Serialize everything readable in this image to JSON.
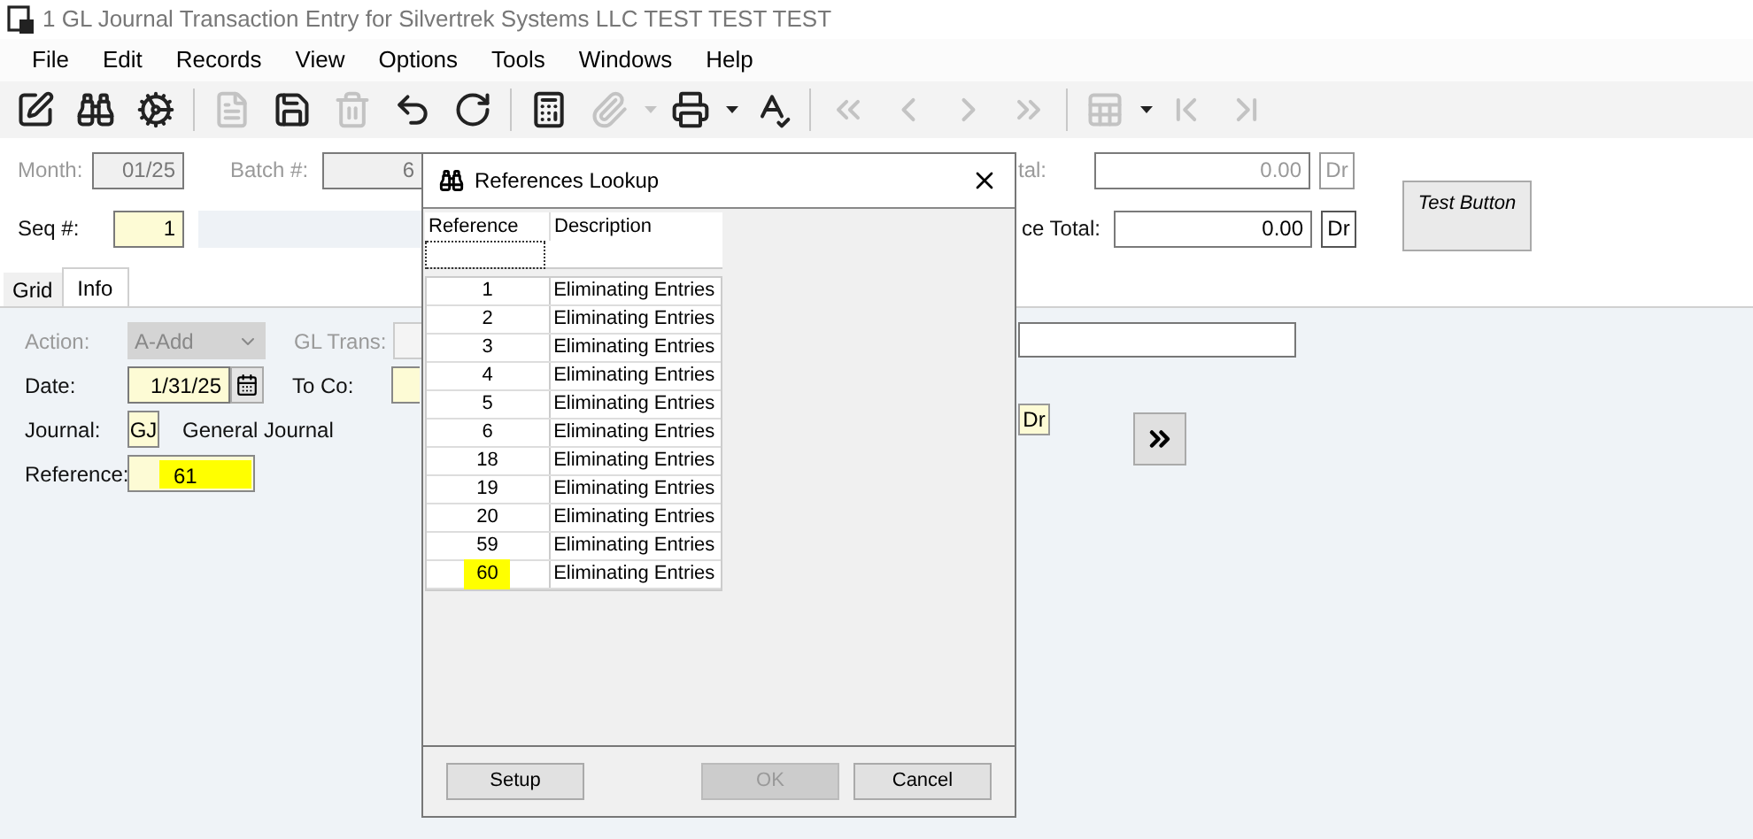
{
  "window": {
    "title": "1 GL Journal Transaction Entry for Silvertrek Systems LLC TEST TEST TEST"
  },
  "menu": [
    "File",
    "Edit",
    "Records",
    "View",
    "Options",
    "Tools",
    "Windows",
    "Help"
  ],
  "toolbar": [
    {
      "kind": "edit",
      "disabled": false
    },
    {
      "kind": "find",
      "disabled": false
    },
    {
      "kind": "gear",
      "disabled": false
    },
    {
      "kind": "separator"
    },
    {
      "kind": "document",
      "disabled": true
    },
    {
      "kind": "save",
      "disabled": false
    },
    {
      "kind": "trash",
      "disabled": true
    },
    {
      "kind": "undo",
      "disabled": false
    },
    {
      "kind": "redo",
      "disabled": false
    },
    {
      "kind": "separator"
    },
    {
      "kind": "calculator",
      "disabled": false
    },
    {
      "kind": "paperclip",
      "disabled": true
    },
    {
      "kind": "caret",
      "disabled": true
    },
    {
      "kind": "printer",
      "disabled": false
    },
    {
      "kind": "caret",
      "disabled": false
    },
    {
      "kind": "spellcheck",
      "disabled": false
    },
    {
      "kind": "separator"
    },
    {
      "kind": "first",
      "disabled": true
    },
    {
      "kind": "previous",
      "disabled": true
    },
    {
      "kind": "next",
      "disabled": true
    },
    {
      "kind": "last",
      "disabled": true
    },
    {
      "kind": "separator"
    },
    {
      "kind": "grid-settings",
      "disabled": true
    },
    {
      "kind": "caret",
      "disabled": false
    },
    {
      "kind": "begin",
      "disabled": true
    },
    {
      "kind": "end",
      "disabled": true
    }
  ],
  "header": {
    "month": {
      "label": "Month:",
      "value": "01/25"
    },
    "batch": {
      "label": "Batch #:",
      "value": "6"
    },
    "seq": {
      "label": "Seq #:",
      "value": "1"
    },
    "total_1": {
      "label": "tal:",
      "value": "0.00",
      "unit": "Dr",
      "disabled": true
    },
    "total_2": {
      "label": "ce Total:",
      "value": "0.00",
      "unit": "Dr",
      "disabled": false
    },
    "test_button": "Test Button"
  },
  "tabs": [
    {
      "label": "Grid",
      "selected": false
    },
    {
      "label": "Info",
      "selected": true
    }
  ],
  "info": {
    "action": {
      "label": "Action:",
      "value": "A-Add",
      "disabled": true
    },
    "gl_trans": {
      "label": "GL Trans:"
    },
    "date": {
      "label": "Date:",
      "value": "1/31/25"
    },
    "to_co": {
      "label": "To Co:"
    },
    "journal": {
      "label": "Journal:",
      "code": "GJ",
      "name": "General Journal"
    },
    "reference": {
      "label": "Reference:",
      "value": "61",
      "highlighted": true
    },
    "side_unit": "Dr"
  },
  "dialog": {
    "title": "References Lookup",
    "columns": [
      "Reference",
      "Description"
    ],
    "rows": [
      {
        "reference": "1",
        "description": "Eliminating Entries",
        "highlighted": false
      },
      {
        "reference": "2",
        "description": "Eliminating Entries",
        "highlighted": false
      },
      {
        "reference": "3",
        "description": "Eliminating Entries",
        "highlighted": false
      },
      {
        "reference": "4",
        "description": "Eliminating Entries",
        "highlighted": false
      },
      {
        "reference": "5",
        "description": "Eliminating Entries",
        "highlighted": false
      },
      {
        "reference": "6",
        "description": "Eliminating Entries",
        "highlighted": false
      },
      {
        "reference": "18",
        "description": "Eliminating Entries",
        "highlighted": false
      },
      {
        "reference": "19",
        "description": "Eliminating Entries",
        "highlighted": false
      },
      {
        "reference": "20",
        "description": "Eliminating Entries",
        "highlighted": false
      },
      {
        "reference": "59",
        "description": "Eliminating Entries",
        "highlighted": false
      },
      {
        "reference": "60",
        "description": "Eliminating Entries",
        "highlighted": true
      }
    ],
    "buttons": [
      {
        "label": "Setup",
        "disabled": false
      },
      {
        "label": "OK",
        "disabled": true
      },
      {
        "label": "Cancel",
        "disabled": false
      }
    ]
  }
}
